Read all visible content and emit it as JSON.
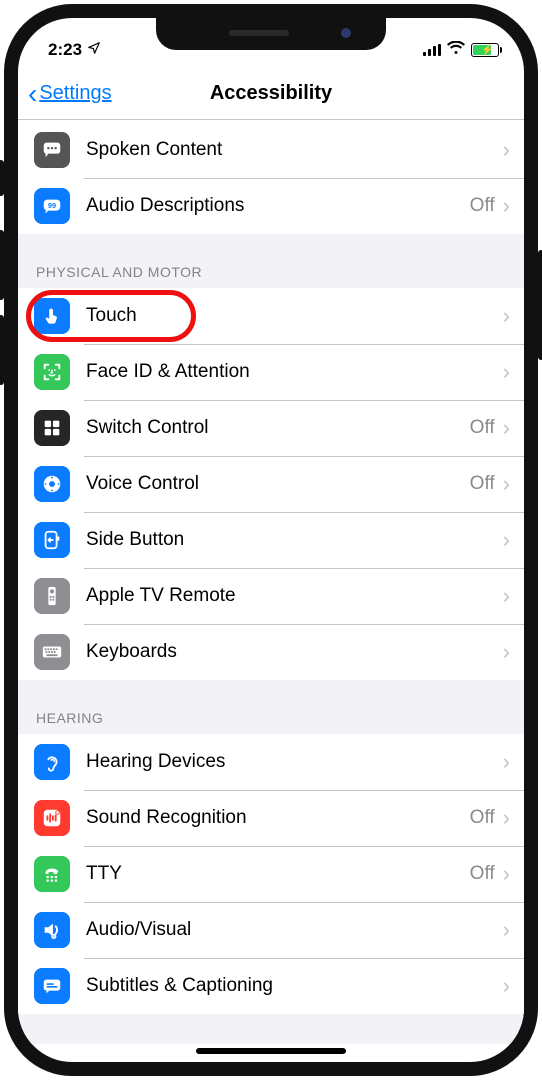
{
  "status": {
    "time": "2:23",
    "loc_glyph": "➤"
  },
  "nav": {
    "back_label": "Settings",
    "title": "Accessibility"
  },
  "values": {
    "off": "Off"
  },
  "top_rows": [
    {
      "key": "spoken",
      "label": "Spoken Content",
      "detail": "",
      "icon_bg": "#555",
      "icon": "speech-bubble"
    },
    {
      "key": "audiodesc",
      "label": "Audio Descriptions",
      "detail": "Off",
      "icon_bg": "#0b7bff",
      "icon": "ad-bubble"
    }
  ],
  "sections": [
    {
      "header": "PHYSICAL AND MOTOR",
      "rows": [
        {
          "key": "touch",
          "label": "Touch",
          "detail": "",
          "icon_bg": "#0b7bff",
          "icon": "touch",
          "highlight": true
        },
        {
          "key": "faceid",
          "label": "Face ID & Attention",
          "detail": "",
          "icon_bg": "#34c759",
          "icon": "faceid"
        },
        {
          "key": "switch",
          "label": "Switch Control",
          "detail": "Off",
          "icon_bg": "#262626",
          "icon": "grid"
        },
        {
          "key": "voicectl",
          "label": "Voice Control",
          "detail": "Off",
          "icon_bg": "#0b7bff",
          "icon": "voice"
        },
        {
          "key": "sidebtn",
          "label": "Side Button",
          "detail": "",
          "icon_bg": "#0b7bff",
          "icon": "sidebtn"
        },
        {
          "key": "appletv",
          "label": "Apple TV Remote",
          "detail": "",
          "icon_bg": "#8e8e93",
          "icon": "tvremote"
        },
        {
          "key": "keyboards",
          "label": "Keyboards",
          "detail": "",
          "icon_bg": "#8e8e93",
          "icon": "keyboard"
        }
      ]
    },
    {
      "header": "HEARING",
      "rows": [
        {
          "key": "hearingdev",
          "label": "Hearing Devices",
          "detail": "",
          "icon_bg": "#0b7bff",
          "icon": "ear"
        },
        {
          "key": "soundrec",
          "label": "Sound Recognition",
          "detail": "Off",
          "icon_bg": "#ff3b30",
          "icon": "soundrec"
        },
        {
          "key": "tty",
          "label": "TTY",
          "detail": "Off",
          "icon_bg": "#34c759",
          "icon": "tty"
        },
        {
          "key": "av",
          "label": "Audio/Visual",
          "detail": "",
          "icon_bg": "#0b7bff",
          "icon": "av"
        },
        {
          "key": "subs",
          "label": "Subtitles & Captioning",
          "detail": "",
          "icon_bg": "#0b7bff",
          "icon": "subs"
        }
      ]
    }
  ]
}
